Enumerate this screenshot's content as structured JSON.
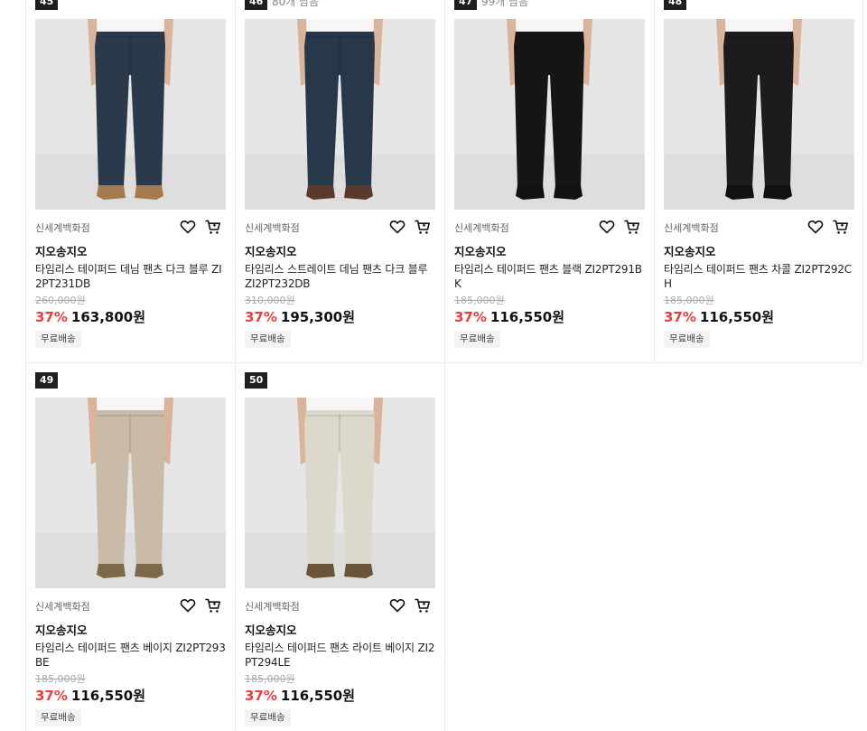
{
  "products": [
    {
      "rank": "45",
      "reviews": "",
      "store": "신세계백화점",
      "brand": "지오송지오",
      "name": "타임리스 테이퍼드 데님 팬츠 다크 블루 ZI2PT231DB",
      "original_price": "260,000원",
      "discount": "37%",
      "price": "163,800원",
      "shipping": "무료배송",
      "pants_color": "#2b3a4a",
      "shoe_color": "#a57b4d"
    },
    {
      "rank": "46",
      "reviews": "80개 남음",
      "store": "신세계백화점",
      "brand": "지오송지오",
      "name": "타임리스 스트레이트 데님 팬츠 다크 블루 ZI2PT232DB",
      "original_price": "310,000원",
      "discount": "37%",
      "price": "195,300원",
      "shipping": "무료배송",
      "pants_color": "#26384a",
      "shoe_color": "#5a3a2c"
    },
    {
      "rank": "47",
      "reviews": "99개 남음",
      "store": "신세계백화점",
      "brand": "지오송지오",
      "name": "타임리스 테이퍼드 팬츠 블랙 ZI2PT291BK",
      "original_price": "185,000원",
      "discount": "37%",
      "price": "116,550원",
      "shipping": "무료배송",
      "pants_color": "#151515",
      "shoe_color": "#111111"
    },
    {
      "rank": "48",
      "reviews": "",
      "store": "신세계백화점",
      "brand": "지오송지오",
      "name": "타임리스 테이퍼드 팬츠 차콜 ZI2PT292CH",
      "original_price": "185,000원",
      "discount": "37%",
      "price": "116,550원",
      "shipping": "무료배송",
      "pants_color": "#1c1c1e",
      "shoe_color": "#111111"
    },
    {
      "rank": "49",
      "reviews": "",
      "store": "신세계백화점",
      "brand": "지오송지오",
      "name": "타임리스 테이퍼드 팬츠 베이지 ZI2PT293BE",
      "original_price": "185,000원",
      "discount": "37%",
      "price": "116,550원",
      "shipping": "무료배송",
      "pants_color": "#c9bba8",
      "shoe_color": "#7a6a4a"
    },
    {
      "rank": "50",
      "reviews": "",
      "store": "신세계백화점",
      "brand": "지오송지오",
      "name": "타임리스 테이퍼드 팬츠 라이트 베이지 ZI2PT294LE",
      "original_price": "185,000원",
      "discount": "37%",
      "price": "116,550원",
      "shipping": "무료배송",
      "pants_color": "#dcd8cb",
      "shoe_color": "#6a5438"
    }
  ],
  "icons": {
    "wish": "heart-icon",
    "cart": "cart-icon"
  },
  "colors": {
    "discount": "#f23c3c",
    "rank_badge": "#1f1f1f",
    "photo_bg": "#e6e6e6"
  }
}
